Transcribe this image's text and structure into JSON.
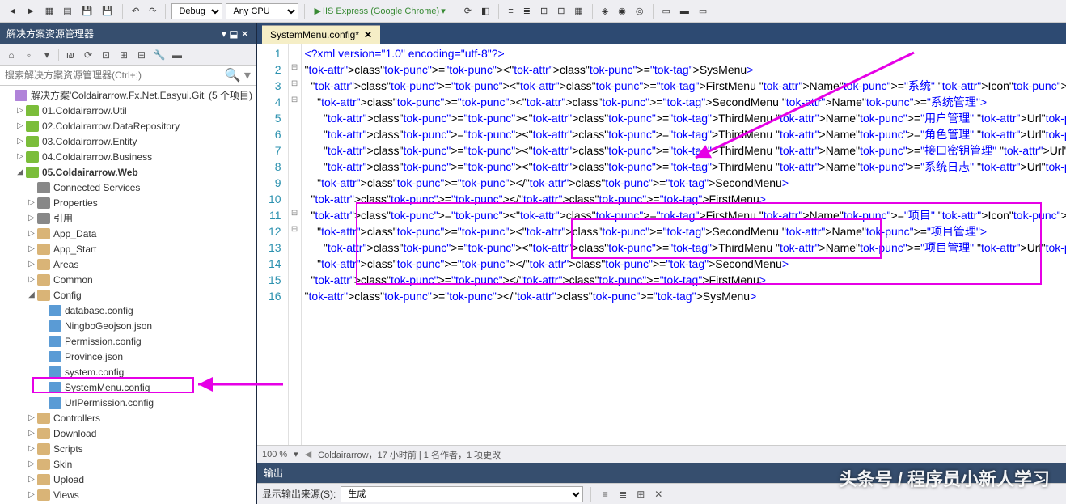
{
  "toolbar": {
    "config": "Debug",
    "platform": "Any CPU",
    "runLabel": "IIS Express (Google Chrome)"
  },
  "panel": {
    "title": "解决方案资源管理器",
    "searchPlaceholder": "搜索解决方案资源管理器(Ctrl+;)",
    "solution": "解决方案'Coldairarrow.Fx.Net.Easyui.Git' (5 个项目)",
    "projects": [
      "01.Coldairarrow.Util",
      "02.Coldairarrow.DataRepository",
      "03.Coldairarrow.Entity",
      "04.Coldairarrow.Business",
      "05.Coldairarrow.Web"
    ],
    "webChildren": {
      "connected": "Connected Services",
      "properties": "Properties",
      "refs": "引用",
      "folders": [
        "App_Data",
        "App_Start",
        "Areas",
        "Common",
        "Config"
      ],
      "configFiles": [
        "database.config",
        "NingboGeojson.json",
        "Permission.config",
        "Province.json",
        "system.config",
        "SystemMenu.config",
        "UrlPermission.config"
      ],
      "afterConfig": [
        "Controllers",
        "Download",
        "Scripts",
        "Skin",
        "Upload",
        "Views"
      ]
    }
  },
  "tab": {
    "name": "SystemMenu.config*"
  },
  "code": {
    "lines": [
      {
        "n": 1,
        "f": "",
        "t": "<?xml version=\"1.0\" encoding=\"utf-8\"?>",
        "type": "decl"
      },
      {
        "n": 2,
        "f": "⊟",
        "t": "<SysMenu>"
      },
      {
        "n": 3,
        "f": "⊟",
        "t": "  <FirstMenu Name=\"系统\" Icon=\"icon_menu_sys\">"
      },
      {
        "n": 4,
        "f": "⊟",
        "t": "    <SecondMenu Name=\"系统管理\">"
      },
      {
        "n": 5,
        "f": "",
        "t": "      <ThirdMenu Name=\"用户管理\" Url=\"~/Base_SysManage/Base_User/Index\" Permission=\"sysuser.search"
      },
      {
        "n": 6,
        "f": "",
        "t": "      <ThirdMenu Name=\"角色管理\" Url=\"~/Base_SysManage/Base_SysRole/Index\" Permission=\"sysrole.sea"
      },
      {
        "n": 7,
        "f": "",
        "t": "      <ThirdMenu Name=\"接口密钥管理\" Url=\"~/Base_SysManage/Base_AppSecret/Index\" Permission=\"appsec"
      },
      {
        "n": 8,
        "f": "",
        "t": "      <ThirdMenu Name=\"系统日志\" Url=\"~/Base_SysManage/Base_SysLog/Index\" Permission=\"sysLog.search"
      },
      {
        "n": 9,
        "f": "",
        "t": "    </SecondMenu>"
      },
      {
        "n": 10,
        "f": "",
        "t": "  </FirstMenu>"
      },
      {
        "n": 11,
        "f": "⊟",
        "t": "  <FirstMenu Name=\"项目\" Icon=\"icon_menu_sys\">"
      },
      {
        "n": 12,
        "f": "⊟",
        "t": "    <SecondMenu Name=\"项目管理\">"
      },
      {
        "n": 13,
        "f": "",
        "t": "      <ThirdMenu Name=\"项目管理\" Url=\"~/ProjectManage/Dev_Project/Index\" Permission=\"\" />"
      },
      {
        "n": 14,
        "f": "",
        "t": "    </SecondMenu>"
      },
      {
        "n": 15,
        "f": "",
        "t": "  </FirstMenu>"
      },
      {
        "n": 16,
        "f": "",
        "t": "</SysMenu>"
      }
    ]
  },
  "status": {
    "zoom": "100 %",
    "blame": "Coldairarrow，17 小时前 | 1 名作者，1 项更改"
  },
  "output": {
    "title": "输出",
    "sourceLabel": "显示输出来源(S):",
    "source": "生成"
  },
  "watermark": "头条号 / 程序员小新人学习"
}
